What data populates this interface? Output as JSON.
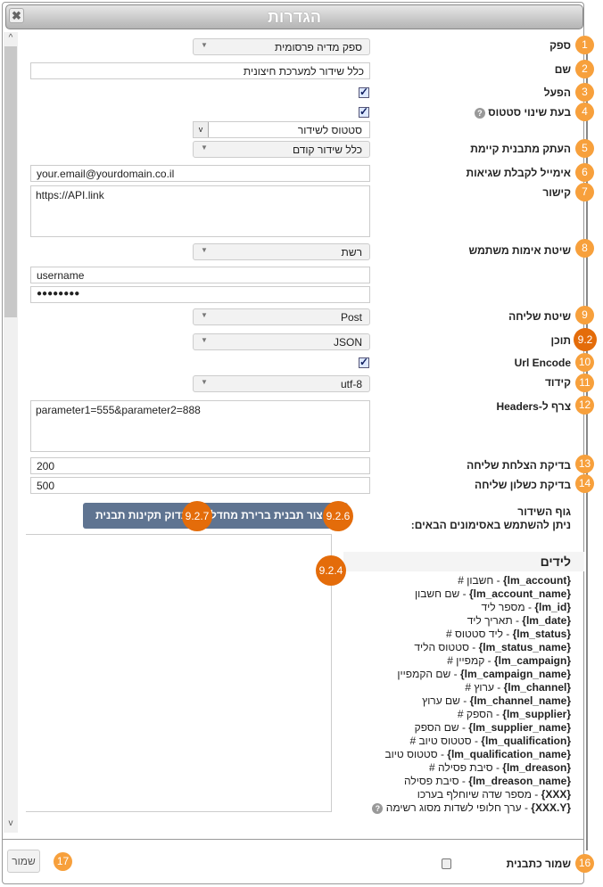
{
  "dialog": {
    "title": "הגדרות",
    "close_icon": "close-icon"
  },
  "colors": {
    "badge": "#f7a03c",
    "badge_dark": "#e46c0a",
    "button": "#5f7491"
  },
  "fields": {
    "supplier": {
      "badge": "1",
      "label": "ספק",
      "value": "ספק מדיה פרסומית"
    },
    "name": {
      "badge": "2",
      "label": "שם",
      "value": "כלל שידור למערכת חיצונית"
    },
    "enable": {
      "badge": "3",
      "label": "הפעל",
      "checked": true
    },
    "on_status_change": {
      "badge": "4",
      "label": "בעת שינוי סטטוס",
      "checked": true,
      "status_value": "סטטוס לשידור"
    },
    "copy_template": {
      "badge": "5",
      "label": "העתק מתבנית קיימת",
      "value": "כלל שידור קודם"
    },
    "error_email": {
      "badge": "6",
      "label": "אימייל לקבלת שגיאות",
      "value": "your.email@yourdomain.co.il"
    },
    "link": {
      "badge": "7",
      "label": "קישור",
      "value": "https://API.link"
    },
    "auth": {
      "badge": "8",
      "label": "שיטת אימות משתמש",
      "value": "רשת",
      "username": "username",
      "password": "●●●●●●●●"
    },
    "method": {
      "badge": "9",
      "label": "שיטת שליחה",
      "value": "Post"
    },
    "content": {
      "badge": "9.2",
      "label": "תוכן",
      "value": "JSON"
    },
    "url_encode": {
      "badge": "10",
      "label": "Url Encode",
      "checked": true
    },
    "encoding": {
      "badge": "11",
      "label": "קידוד",
      "value": "utf-8"
    },
    "headers": {
      "badge": "12",
      "label": "צרף ל-Headers",
      "value": "parameter1=555&parameter2=888"
    },
    "success_check": {
      "badge": "13",
      "label": "בדיקת הצלחת שליחה",
      "value": "200"
    },
    "failure_check": {
      "badge": "14",
      "label": "בדיקת כשלון שליחה",
      "value": "500"
    },
    "body": {
      "label": "גוף השידור",
      "hint": "ניתן להשתמש באסימונים הבאים:",
      "badge": "9.2.4"
    }
  },
  "buttons": {
    "default_template": {
      "label": "צור תבנית ברירת מחדל",
      "badge": "9.2.6"
    },
    "validate_template": {
      "label": "בדוק תקינות תבנית",
      "badge": "9.2.7"
    }
  },
  "leads": {
    "title": "לידים",
    "items": [
      {
        "token": "{lm_account}",
        "desc": "חשבון #"
      },
      {
        "token": "{lm_account_name}",
        "desc": "שם חשבון"
      },
      {
        "token": "{lm_id}",
        "desc": "מספר ליד"
      },
      {
        "token": "{lm_date}",
        "desc": "תאריך ליד"
      },
      {
        "token": "{lm_status}",
        "desc": "ליד סטטוס #"
      },
      {
        "token": "{lm_status_name}",
        "desc": "סטטוס הליד"
      },
      {
        "token": "{lm_campaign}",
        "desc": "קמפיין #"
      },
      {
        "token": "{lm_campaign_name}",
        "desc": "שם הקמפיין"
      },
      {
        "token": "{lm_channel}",
        "desc": "ערוץ #"
      },
      {
        "token": "{lm_channel_name}",
        "desc": "שם ערוץ"
      },
      {
        "token": "{lm_supplier}",
        "desc": "הספק #"
      },
      {
        "token": "{lm_supplier_name}",
        "desc": "שם הספק"
      },
      {
        "token": "{lm_qualification}",
        "desc": "סטטוס טיוב #"
      },
      {
        "token": "{lm_qualification_name}",
        "desc": "סטטוס טיוב"
      },
      {
        "token": "{lm_dreason}",
        "desc": "סיבת פסילה #"
      },
      {
        "token": "{lm_dreason_name}",
        "desc": "סיבת פסילה"
      },
      {
        "token": "{XXX}",
        "desc": "מספר שדה שיוחלף בערכו"
      },
      {
        "token": "{XXX.Y}",
        "desc": "ערך חלופי לשדות מסוג רשימה"
      }
    ]
  },
  "footer": {
    "save_template": {
      "badge": "16",
      "label": "שמור כתבנית",
      "checked": false
    },
    "save": {
      "badge": "17",
      "label": "שמור"
    }
  }
}
